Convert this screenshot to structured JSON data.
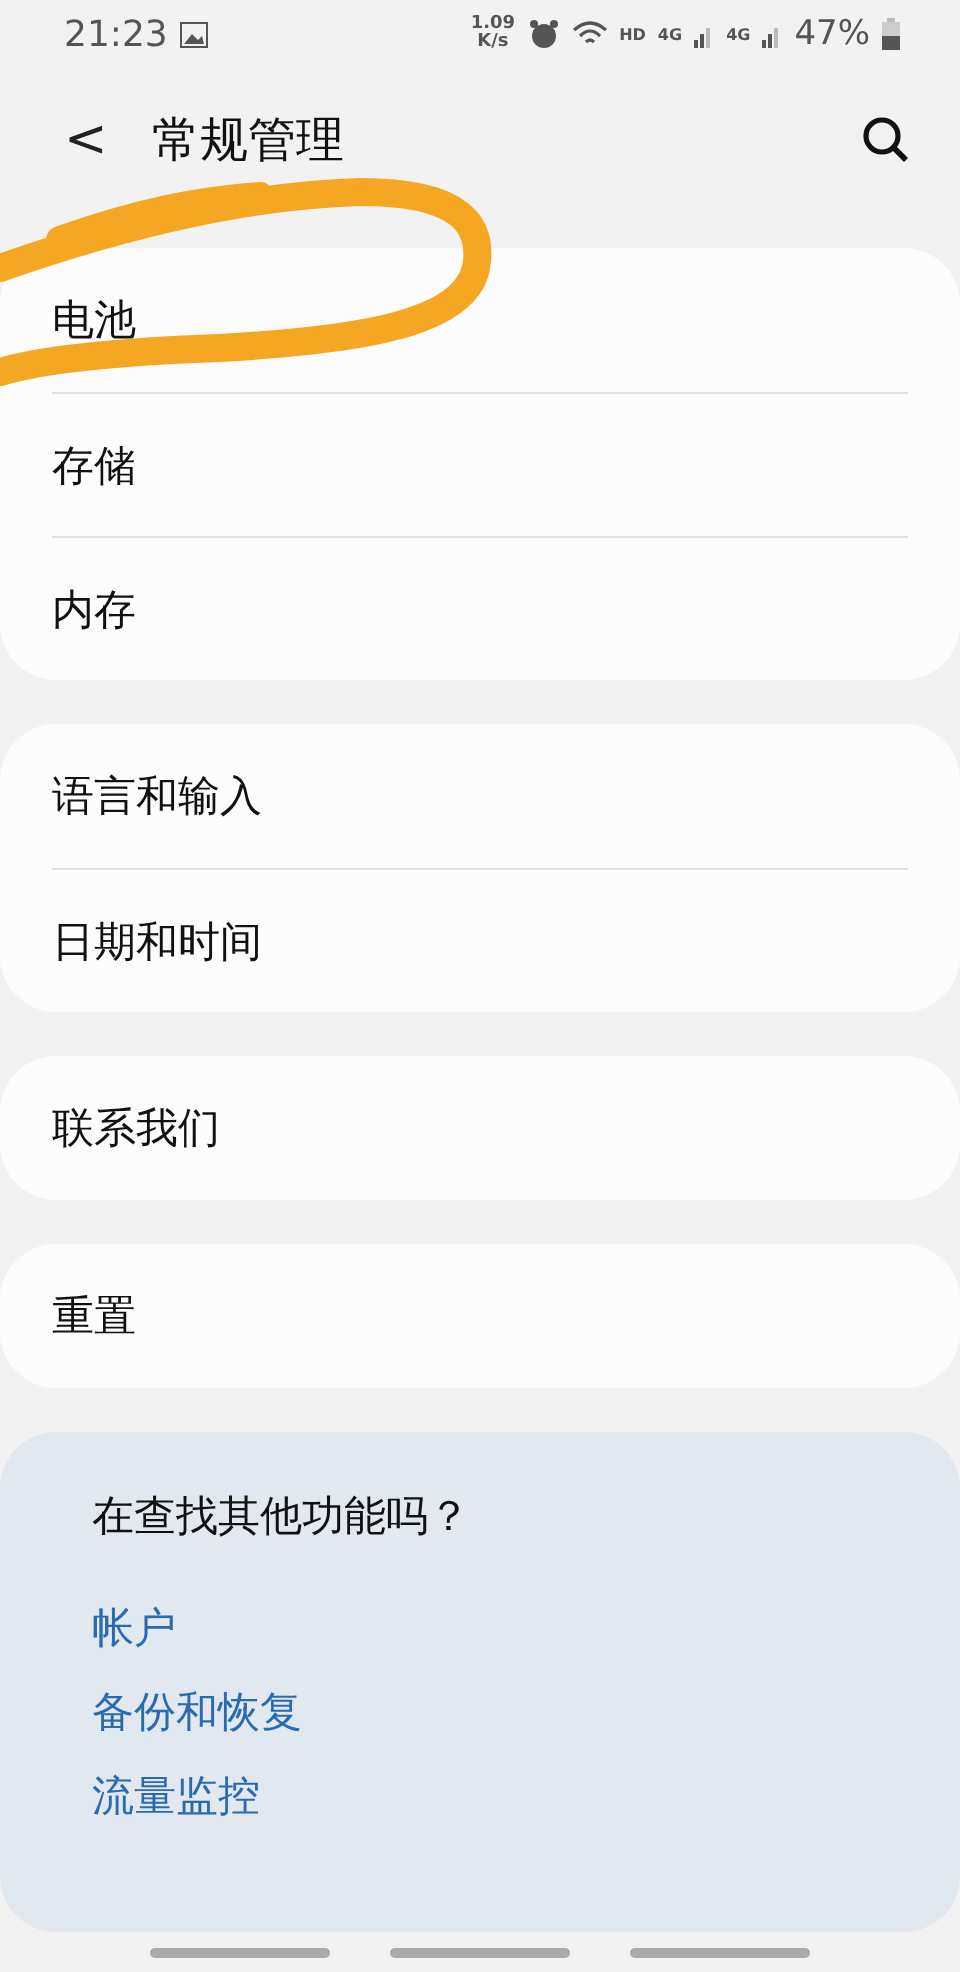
{
  "status_bar": {
    "time": "21:23",
    "speed_value": "1.09",
    "speed_unit": "K/s",
    "hd": "HD",
    "networks": [
      "4G",
      "4G"
    ],
    "battery": "47%"
  },
  "header": {
    "back": "<",
    "title": "常规管理"
  },
  "groups": [
    {
      "items": [
        {
          "label": "电池",
          "circled": true
        },
        {
          "label": "存储",
          "circled": false
        },
        {
          "label": "内存",
          "circled": false
        }
      ]
    },
    {
      "items": [
        {
          "label": "语言和输入",
          "circled": false
        },
        {
          "label": "日期和时间",
          "circled": false
        }
      ]
    },
    {
      "items": [
        {
          "label": "联系我们",
          "circled": false
        }
      ]
    },
    {
      "items": [
        {
          "label": "重置",
          "circled": false
        }
      ]
    }
  ],
  "suggestions": {
    "title": "在查找其他功能吗？",
    "links": [
      "帐户",
      "备份和恢复",
      "流量监控"
    ]
  }
}
